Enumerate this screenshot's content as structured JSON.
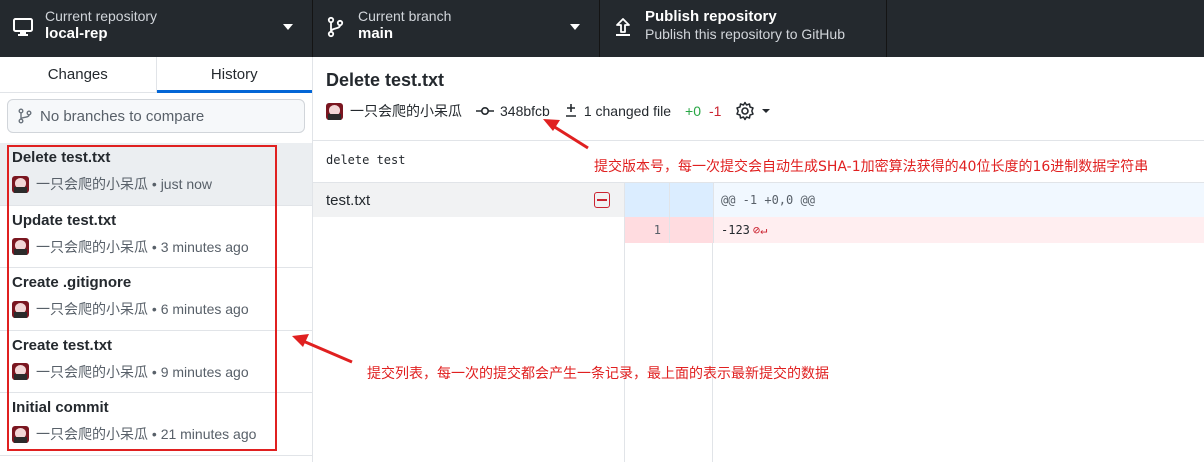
{
  "toolbar": {
    "repo_label": "Current repository",
    "repo_value": "local-rep",
    "branch_label": "Current branch",
    "branch_value": "main",
    "publish_title": "Publish repository",
    "publish_subtitle": "Publish this repository to GitHub"
  },
  "sidebar": {
    "tabs": [
      {
        "label": "Changes",
        "active": false
      },
      {
        "label": "History",
        "active": true
      }
    ],
    "compare_placeholder": "No branches to compare",
    "commits": [
      {
        "title": "Delete test.txt",
        "author": "一只会爬的小呆瓜",
        "time": "just now",
        "selected": true
      },
      {
        "title": "Update test.txt",
        "author": "一只会爬的小呆瓜",
        "time": "3 minutes ago",
        "selected": false
      },
      {
        "title": "Create .gitignore",
        "author": "一只会爬的小呆瓜",
        "time": "6 minutes ago",
        "selected": false
      },
      {
        "title": "Create test.txt",
        "author": "一只会爬的小呆瓜",
        "time": "9 minutes ago",
        "selected": false
      },
      {
        "title": "Initial commit",
        "author": "一只会爬的小呆瓜",
        "time": "21 minutes ago",
        "selected": false
      }
    ]
  },
  "commit": {
    "summary": "Delete test.txt",
    "author": "一只会爬的小呆瓜",
    "sha": "348bfcb",
    "changed_files": "1 changed file",
    "additions": "+0",
    "deletions": "-1",
    "description": "delete test"
  },
  "files": [
    {
      "name": "test.txt",
      "status": "deleted"
    }
  ],
  "diff": {
    "hunk_header": "@@ -1 +0,0 @@",
    "lines": [
      {
        "old_num": "1",
        "new_num": "",
        "text": "-123",
        "type": "del"
      }
    ]
  },
  "annotations": {
    "sha_note": "提交版本号，每一次提交会自动生成SHA-1加密算法获得的40位长度的16进制数据字符串",
    "list_note": "提交列表，每一次的提交都会产生一条记录，最上面的表示最新提交的数据"
  },
  "colors": {
    "toolbar_bg": "#24292e",
    "accent": "#0366d6",
    "annotation_red": "#e02020",
    "additions": "#28a745",
    "deletions": "#cb2431"
  }
}
